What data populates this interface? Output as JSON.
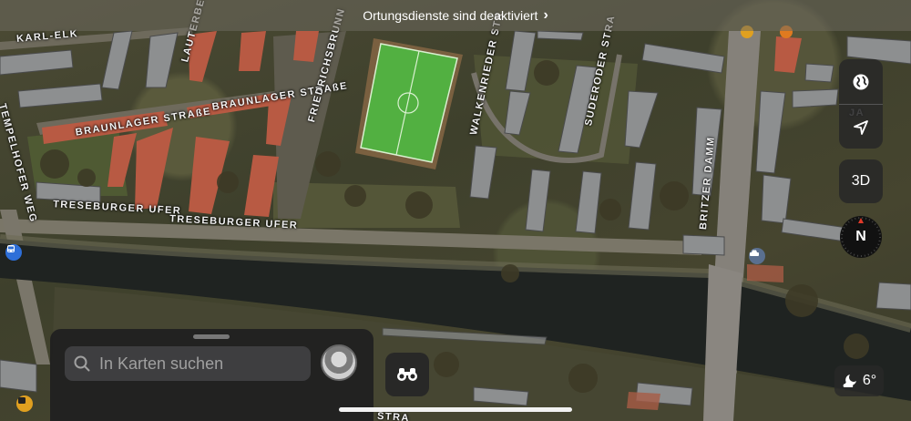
{
  "banner": {
    "text": "Ortungsdienste sind deaktiviert",
    "chevron": "›"
  },
  "streets": {
    "karl_elk": "KARL-ELK",
    "lauterberger": "LAUTERBERGER",
    "braunlager_1": "BRAUNLAGER STRAßE",
    "braunlager_2": "BRAUNLAGER STRAßE",
    "friedrichsbrunner": "FRIEDRICHSBRUNN",
    "walkenrieder": "WALKENRIEDER STR",
    "suderoder": "SUDERODER STRA",
    "tempelhofer": "TEMPELHOFER WEG",
    "treseburger_1": "TRESEBURGER UFER",
    "treseburger_2": "TRESEBURGER UFER",
    "britzer": "BRITZER DAMM",
    "ja": "JA",
    "bottom": "STRA"
  },
  "controls": {
    "globe_icon": "globe-icon",
    "location_icon": "location-arrow-icon",
    "btn_3d": "3D",
    "compass": "N"
  },
  "weather": {
    "icon": "moon-cloud-icon",
    "temp": "6°"
  },
  "search": {
    "placeholder": "In Karten suchen",
    "value": ""
  }
}
